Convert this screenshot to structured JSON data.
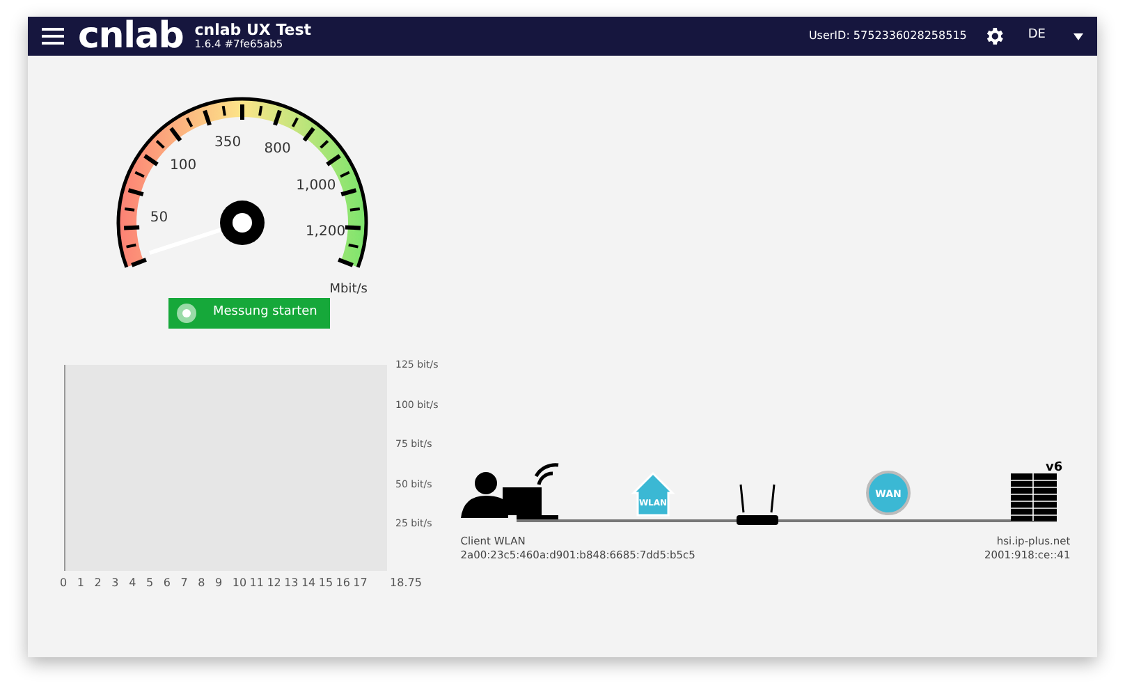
{
  "header": {
    "logo": "cnlab",
    "title": "cnlab UX Test",
    "version": "1.6.4 #7fe65ab5",
    "user_id": "UserID: 5752336028258515",
    "language": "DE"
  },
  "gauge": {
    "labels": [
      "50",
      "100",
      "350",
      "800",
      "1,000",
      "1,200"
    ],
    "unit": "Mbit/s"
  },
  "start_button": {
    "label": "Messung starten"
  },
  "throughput_chart": {
    "y_labels": [
      "125 bit/s",
      "100 bit/s",
      "75 bit/s",
      "50 bit/s",
      "25 bit/s"
    ],
    "x_labels": [
      "0",
      "1",
      "2",
      "3",
      "4",
      "5",
      "6",
      "7",
      "8",
      "9",
      "10",
      "11",
      "12",
      "13",
      "14",
      "15",
      "16",
      "17",
      "18.75"
    ]
  },
  "network": {
    "wlan_label": "WLAN",
    "wan_label": "WAN",
    "server_label": "v6",
    "client_name": "Client WLAN",
    "client_address": "2a00:23c5:460a:d901:b848:6685:7dd5:b5c5",
    "server_host": "hsi.ip-plus.net",
    "server_address": "2001:918:ce::41"
  }
}
